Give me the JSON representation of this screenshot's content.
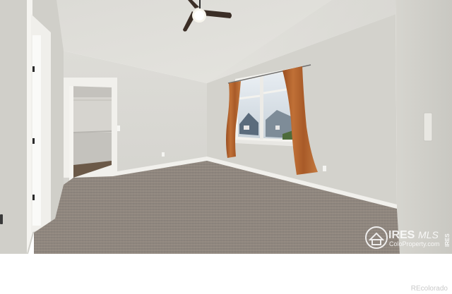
{
  "watermark": {
    "brand": "IRES",
    "brand_suffix": "MLS",
    "subtitle": "ColoProperty.com",
    "side_text": "IRES"
  },
  "credit": "REcolorado",
  "colors": {
    "wall": "#d9d8d3",
    "ceiling": "#e4e3de",
    "carpet": "#8f867e",
    "curtain": "#b5642e",
    "trim": "#f4f3ef"
  }
}
